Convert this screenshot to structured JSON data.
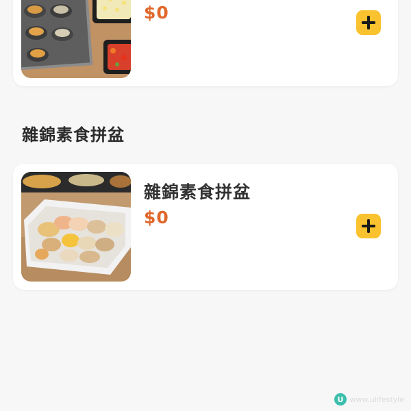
{
  "items": [
    {
      "image": "seafood-and-vegetables-photo",
      "price": "$0",
      "add_icon": "plus-icon"
    },
    {
      "image": "assorted-vegetarian-platter-photo",
      "title": "雜錦素食拼盆",
      "price": "$0",
      "add_icon": "plus-icon"
    }
  ],
  "section": {
    "title": "雜錦素食拼盆"
  },
  "watermark": {
    "logo": "U",
    "text": "www.ulifestyle"
  },
  "colors": {
    "background": "#f7f7f7",
    "price": "#e0672b",
    "add_button": "#f9c22e",
    "title": "#333333"
  }
}
